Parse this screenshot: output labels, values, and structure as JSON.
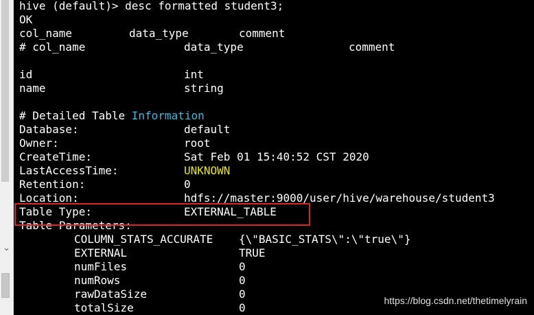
{
  "terminal": {
    "command_line": "hive (default)> desc formatted student3;",
    "status": "OK",
    "header_plain": {
      "c1": "col_name",
      "c2": "data_type",
      "c3": "comment"
    },
    "header_hash": {
      "c1": "# col_name",
      "c2": "data_type",
      "c3": "comment"
    },
    "columns": [
      {
        "name": "id",
        "type": "int"
      },
      {
        "name": "name",
        "type": "string"
      }
    ],
    "detail_title": {
      "prefix": "# Detailed Table ",
      "highlight": "Information"
    },
    "detail_rows": [
      {
        "key": "Database:",
        "value": "default"
      },
      {
        "key": "Owner:",
        "value": "root"
      },
      {
        "key": "CreateTime:",
        "value": "Sat Feb 01 15:40:52 CST 2020"
      },
      {
        "key": "LastAccessTime:",
        "value": "UNKNOWN"
      },
      {
        "key": "Retention:",
        "value": "0"
      },
      {
        "key": "Location:",
        "value": "hdfs://master:9000/user/hive/warehouse/student3"
      },
      {
        "key": "Table Type:",
        "value": "EXTERNAL_TABLE"
      }
    ],
    "params_title": "Table Parameters:",
    "params": [
      {
        "key": "COLUMN_STATS_ACCURATE",
        "value": "{\\\"BASIC_STATS\\\":\\\"true\\\"}"
      },
      {
        "key": "EXTERNAL",
        "value": "TRUE"
      },
      {
        "key": "numFiles",
        "value": "0"
      },
      {
        "key": "numRows",
        "value": "0"
      },
      {
        "key": "rawDataSize",
        "value": "0"
      },
      {
        "key": "totalSize",
        "value": "0"
      }
    ]
  },
  "scrollbar": {
    "arrow_icon": "chevron-down-icon",
    "arrow_glyph": "⌄"
  },
  "watermark": "https://blog.csdn.net/thetimelyrain",
  "colors": {
    "background": "#000000",
    "text": "#ffffff",
    "keyword": "#3fb9e0",
    "unknown": "#e8e800",
    "highlight_box": "#d9262a"
  }
}
